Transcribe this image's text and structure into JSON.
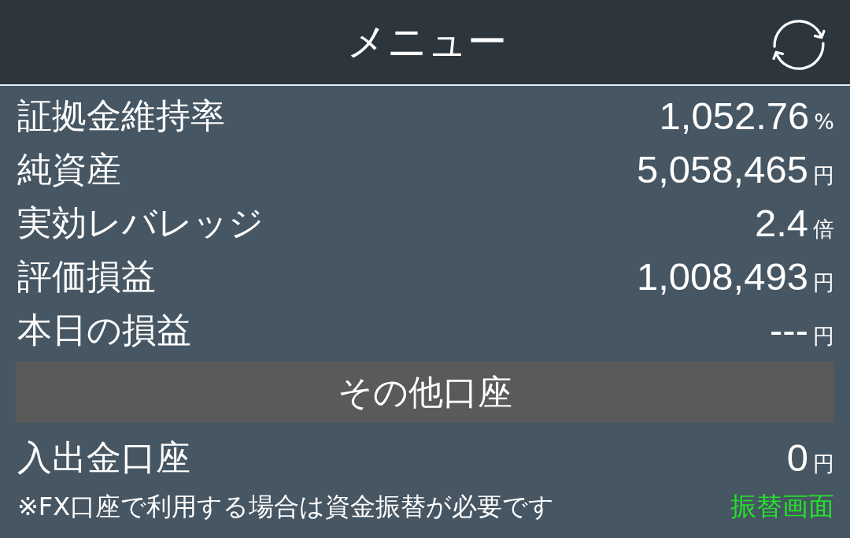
{
  "header": {
    "title": "メニュー"
  },
  "summary": [
    {
      "label": "証拠金維持率",
      "value": "1,052.76",
      "unit": "%"
    },
    {
      "label": "純資産",
      "value": "5,058,465",
      "unit": "円"
    },
    {
      "label": "実効レバレッジ",
      "value": "2.4",
      "unit": "倍"
    },
    {
      "label": "評価損益",
      "value": "1,008,493",
      "unit": "円"
    },
    {
      "label": "本日の損益",
      "value": "---",
      "unit": "円"
    }
  ],
  "section": {
    "title": "その他口座"
  },
  "accounts": [
    {
      "label": "入出金口座",
      "value": "0",
      "unit": "円"
    }
  ],
  "note": {
    "text": "※FX口座で利用する場合は資金振替が必要です",
    "link": "振替画面"
  }
}
